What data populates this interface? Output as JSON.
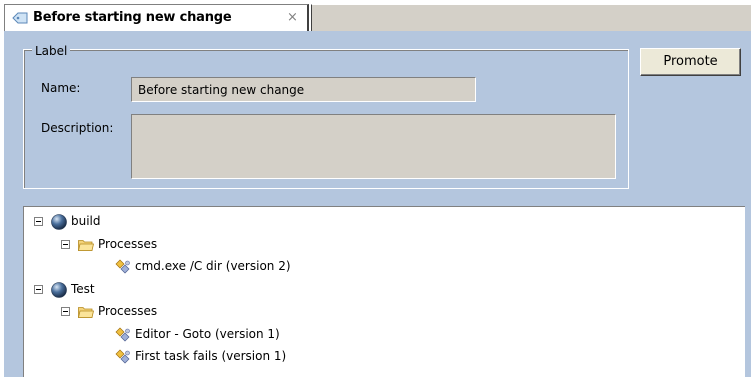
{
  "tab": {
    "title": "Before starting new change",
    "close_glyph": "×",
    "icon": "label-icon"
  },
  "label_group": {
    "legend": "Label",
    "name_label": "Name:",
    "name_value": "Before starting new change",
    "description_label": "Description:",
    "description_value": ""
  },
  "promote_button": "Promote",
  "tree": {
    "nodes": [
      {
        "label": "build",
        "icon": "globe-icon",
        "level": 0,
        "expanded": true
      },
      {
        "label": "Processes",
        "icon": "folder-icon",
        "level": 1,
        "expanded": true
      },
      {
        "label": "cmd.exe /C dir (version 2)",
        "icon": "process-icon",
        "level": 2
      },
      {
        "label": "Test",
        "icon": "globe-icon",
        "level": 0,
        "expanded": true
      },
      {
        "label": "Processes",
        "icon": "folder-icon",
        "level": 1,
        "expanded": true
      },
      {
        "label": "Editor - Goto (version 1)",
        "icon": "process-icon",
        "level": 2
      },
      {
        "label": "First task fails (version 1)",
        "icon": "process-icon",
        "level": 2
      }
    ]
  },
  "colors": {
    "panel_bg": "#b4c6de",
    "field_bg": "#d4d0c8"
  }
}
